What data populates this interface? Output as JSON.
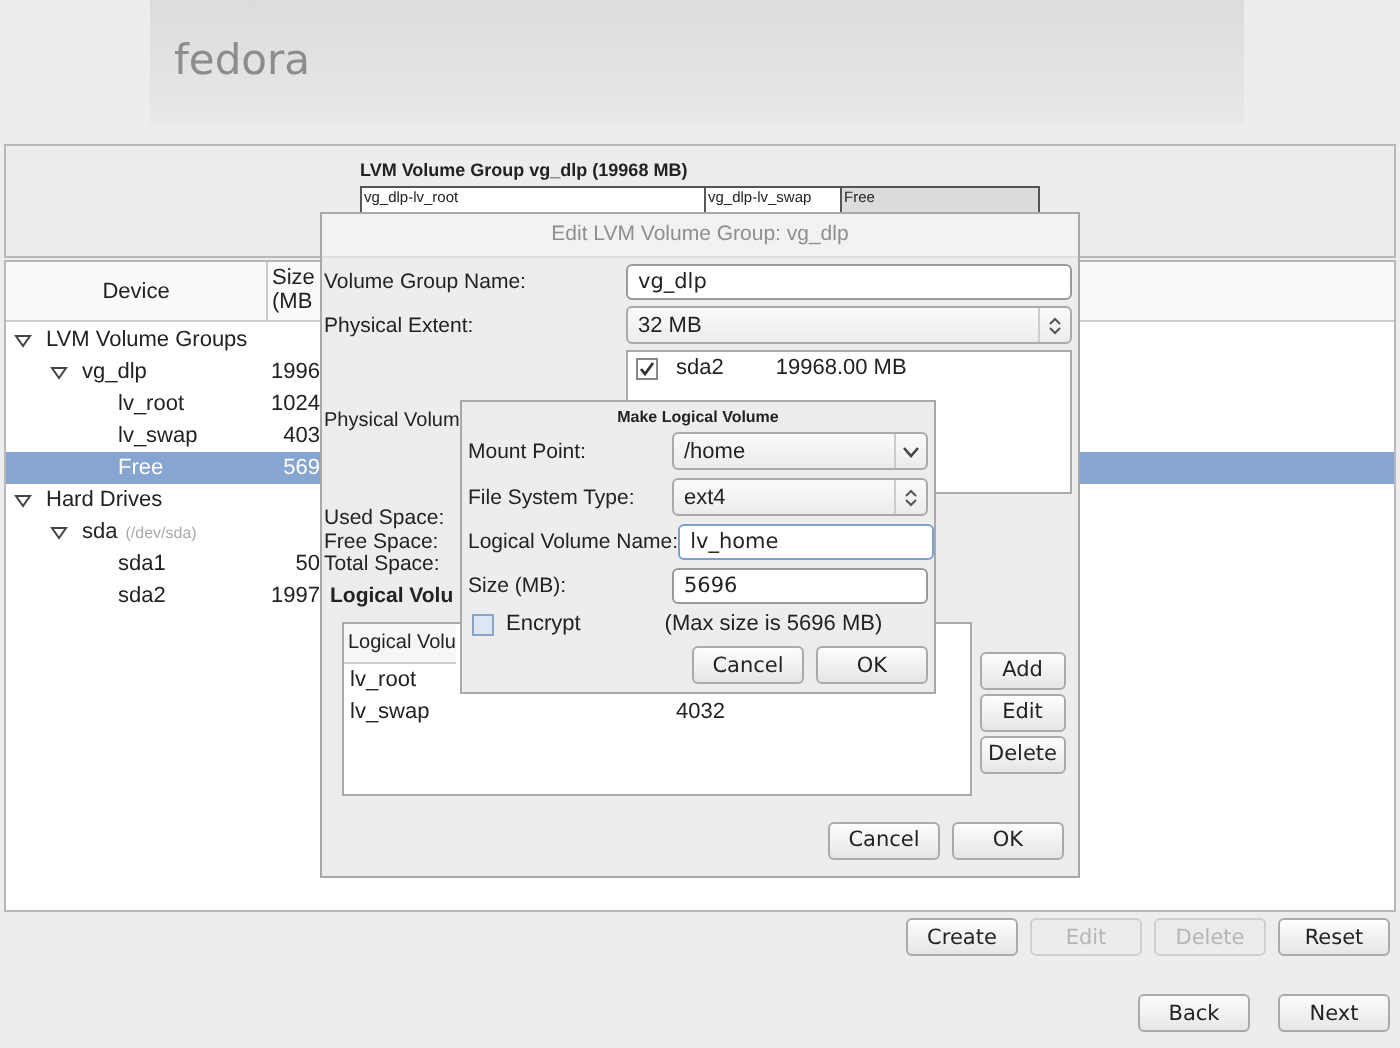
{
  "header": {
    "logo": "fedora"
  },
  "volume_group": {
    "title": "LVM Volume Group vg_dlp (19968 MB)",
    "segments": [
      {
        "label": "vg_dlp-lv_root",
        "kind": "used"
      },
      {
        "label": "vg_dlp-lv_swap",
        "kind": "used"
      },
      {
        "label": "Free",
        "kind": "free"
      }
    ]
  },
  "device_table": {
    "columns": [
      "Device",
      "Size (MB"
    ],
    "rows": [
      {
        "device": "LVM Volume Groups",
        "expanded": true,
        "selected": false,
        "children": [
          {
            "device": "vg_dlp",
            "size": "1996",
            "expanded": true,
            "selected": false,
            "children": [
              {
                "device": "lv_root",
                "size": "1024",
                "selected": false
              },
              {
                "device": "lv_swap",
                "size": "403",
                "selected": false
              },
              {
                "device": "Free",
                "size": "569",
                "selected": true
              }
            ]
          }
        ]
      },
      {
        "device": "Hard Drives",
        "expanded": true,
        "selected": false,
        "children": [
          {
            "device": "sda",
            "hint": "(/dev/sda)",
            "expanded": true,
            "selected": false,
            "children": [
              {
                "device": "sda1",
                "size": "50",
                "selected": false
              },
              {
                "device": "sda2",
                "size": "1997",
                "selected": false
              }
            ]
          }
        ]
      }
    ]
  },
  "buttons": [
    {
      "label": "Create",
      "disabled": false
    },
    {
      "label": "Edit",
      "disabled": true
    },
    {
      "label": "Delete",
      "disabled": true
    },
    {
      "label": "Reset",
      "disabled": false
    }
  ],
  "navigation": [
    {
      "label": "Back"
    },
    {
      "label": "Next"
    }
  ],
  "edit_dialog": {
    "title": "Edit LVM Volume Group: vg_dlp",
    "active": false,
    "name_label": "Volume Group Name:",
    "name_value": "vg_dlp",
    "extent_label": "Physical Extent:",
    "extent_value": "32 MB",
    "pv_label": "Physical Volum",
    "physical_volumes": [
      {
        "name": "sda2",
        "size": "19968.00 MB",
        "checked": true
      }
    ],
    "space_labels": [
      "Used Space:",
      "Free Space:",
      "Total Space:"
    ],
    "lv_heading": "Logical Volu",
    "lv_table": {
      "columns": [
        "Logical Volu"
      ],
      "rows": [
        {
          "name": "lv_root"
        },
        {
          "name": "lv_swap",
          "size": "4032"
        }
      ]
    },
    "side_buttons": [
      "Add",
      "Edit",
      "Delete"
    ],
    "buttons": [
      "Cancel",
      "OK"
    ]
  },
  "make_dialog": {
    "title": "Make Logical Volume",
    "fields": [
      {
        "label": "Mount Point:",
        "kind": "combo",
        "value": "/home",
        "focused": false
      },
      {
        "label": "File System Type:",
        "kind": "spin",
        "value": "ext4",
        "focused": false
      },
      {
        "label": "Logical Volume Name:",
        "kind": "text",
        "value": "lv_home",
        "focused": true
      },
      {
        "label": "Size (MB):",
        "kind": "text",
        "value": "5696",
        "focused": false
      }
    ],
    "encrypt": {
      "label": "Encrypt",
      "checked": false
    },
    "note": "(Max size is 5696 MB)",
    "buttons": [
      "Cancel",
      "OK"
    ]
  }
}
